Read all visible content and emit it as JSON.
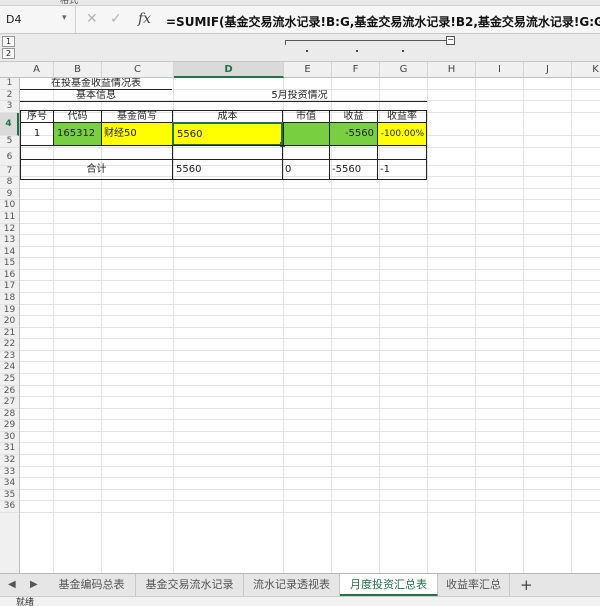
{
  "window": {
    "top_label": "格式"
  },
  "formula_bar": {
    "name_box": "D4",
    "fx_label": "fx",
    "formula": "=SUMIF(基金交易流水记录!B:G,基金交易流水记录!B2,基金交易流水记录!G:G)"
  },
  "outline_levels": [
    "1",
    "2"
  ],
  "columns": [
    "A",
    "B",
    "C",
    "D",
    "E",
    "F",
    "G",
    "H",
    "I",
    "J",
    "K"
  ],
  "selected_column": "D",
  "rows": [
    "1",
    "2",
    "3",
    "4",
    "5",
    "6",
    "7",
    "8",
    "9",
    "10",
    "11",
    "12",
    "13",
    "14",
    "15",
    "16",
    "17",
    "18",
    "19",
    "20",
    "21",
    "22",
    "23",
    "24",
    "25",
    "26",
    "27",
    "28",
    "29",
    "30",
    "31",
    "32",
    "33",
    "34",
    "35",
    "36"
  ],
  "selected_row": "4",
  "sheet": {
    "title": "在投基金收益情况表",
    "section_basic": "基本信息",
    "section_may": "5月投资情况",
    "headers": [
      "序号",
      "代码",
      "基金简写",
      "成本",
      "市值",
      "收益",
      "收益率"
    ],
    "data_row": {
      "seq": "1",
      "code": "165312",
      "name": "财经50",
      "cost": "5560",
      "market": "",
      "profit": "-5560",
      "rate": "-100.00%"
    },
    "total_row": {
      "label": "合计",
      "cost": "5560",
      "market": "0",
      "profit": "-5560",
      "rate": "-1"
    }
  },
  "colors": {
    "yellow": "#ffff00",
    "green": "#78d040",
    "accent": "#217346"
  },
  "tabs": [
    {
      "label": "基金编码总表",
      "active": false
    },
    {
      "label": "基金交易流水记录",
      "active": false
    },
    {
      "label": "流水记录透视表",
      "active": false
    },
    {
      "label": "月度投资汇总表",
      "active": true
    },
    {
      "label": "收益率汇总",
      "active": false
    }
  ],
  "add_tab": "+",
  "status": "就绪"
}
